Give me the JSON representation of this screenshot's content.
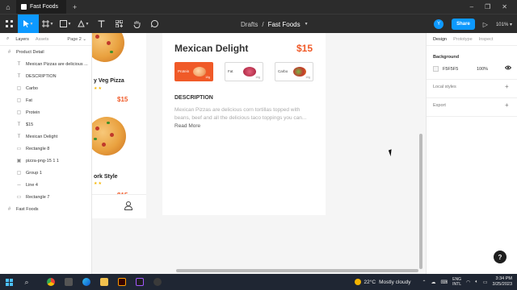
{
  "titlebar": {
    "tab_label": "Fast Foods",
    "new_tab": "+",
    "home_icon": "home-icon",
    "minimize": "–",
    "restore": "❐",
    "close": "✕"
  },
  "toolbar": {
    "breadcrumb_folder": "Drafts",
    "breadcrumb_sep": "/",
    "file_name": "Fast Foods",
    "avatar_initial": "Y",
    "share_label": "Share",
    "zoom": "101%"
  },
  "layers_panel": {
    "tab_layers": "Layers",
    "tab_assets": "Assets",
    "page": "Page 2",
    "frame_name": "Product Detail",
    "children": [
      {
        "label": "Mexican Pizzas are delicious ...",
        "icon": "T"
      },
      {
        "label": "DESCRIPTION",
        "icon": "T"
      },
      {
        "label": "Carbo",
        "icon": "▢"
      },
      {
        "label": "Fat",
        "icon": "▢"
      },
      {
        "label": "Protein",
        "icon": "▢"
      },
      {
        "label": "$15",
        "icon": "T"
      },
      {
        "label": "Mexican Delight",
        "icon": "T"
      },
      {
        "label": "Rectangle 8",
        "icon": "▭"
      },
      {
        "label": "pizza-png-15 1 1",
        "icon": "▣"
      },
      {
        "label": "Group 1",
        "icon": "▢"
      },
      {
        "label": "Line 4",
        "icon": "─"
      },
      {
        "label": "Rectangle 7",
        "icon": "▭"
      }
    ],
    "second_frame": "Fast Foods"
  },
  "canvas": {
    "card1": {
      "name": "y Veg Pizza",
      "price": "$15"
    },
    "card2": {
      "name": "ork Style",
      "price": "$15"
    },
    "detail": {
      "title": "Mexican Delight",
      "price": "$15",
      "chips": [
        {
          "label": "Protein",
          "value": "10g",
          "active": true
        },
        {
          "label": "Fat",
          "value": "10g",
          "active": false
        },
        {
          "label": "Carbo",
          "value": "10g",
          "active": false
        }
      ],
      "desc_heading": "DESCRIPTION",
      "desc_text": "Mexican Pizzas are delicious corn tortillas topped with beans, beef and all the delicious taco toppings you can... ",
      "read_more": "Read More"
    }
  },
  "props_panel": {
    "tab_design": "Design",
    "tab_prototype": "Prototype",
    "tab_inspect": "Inspect",
    "background_label": "Background",
    "bg_hex": "F5F5F5",
    "bg_opacity": "100%",
    "local_styles": "Local styles",
    "export": "Export",
    "help": "?"
  },
  "taskbar": {
    "weather_temp": "22°C",
    "weather_desc": "Mostly cloudy",
    "lang_top": "ENG",
    "lang_bottom": "INTL",
    "time": "3:34 PM",
    "date": "3/25/2023"
  }
}
